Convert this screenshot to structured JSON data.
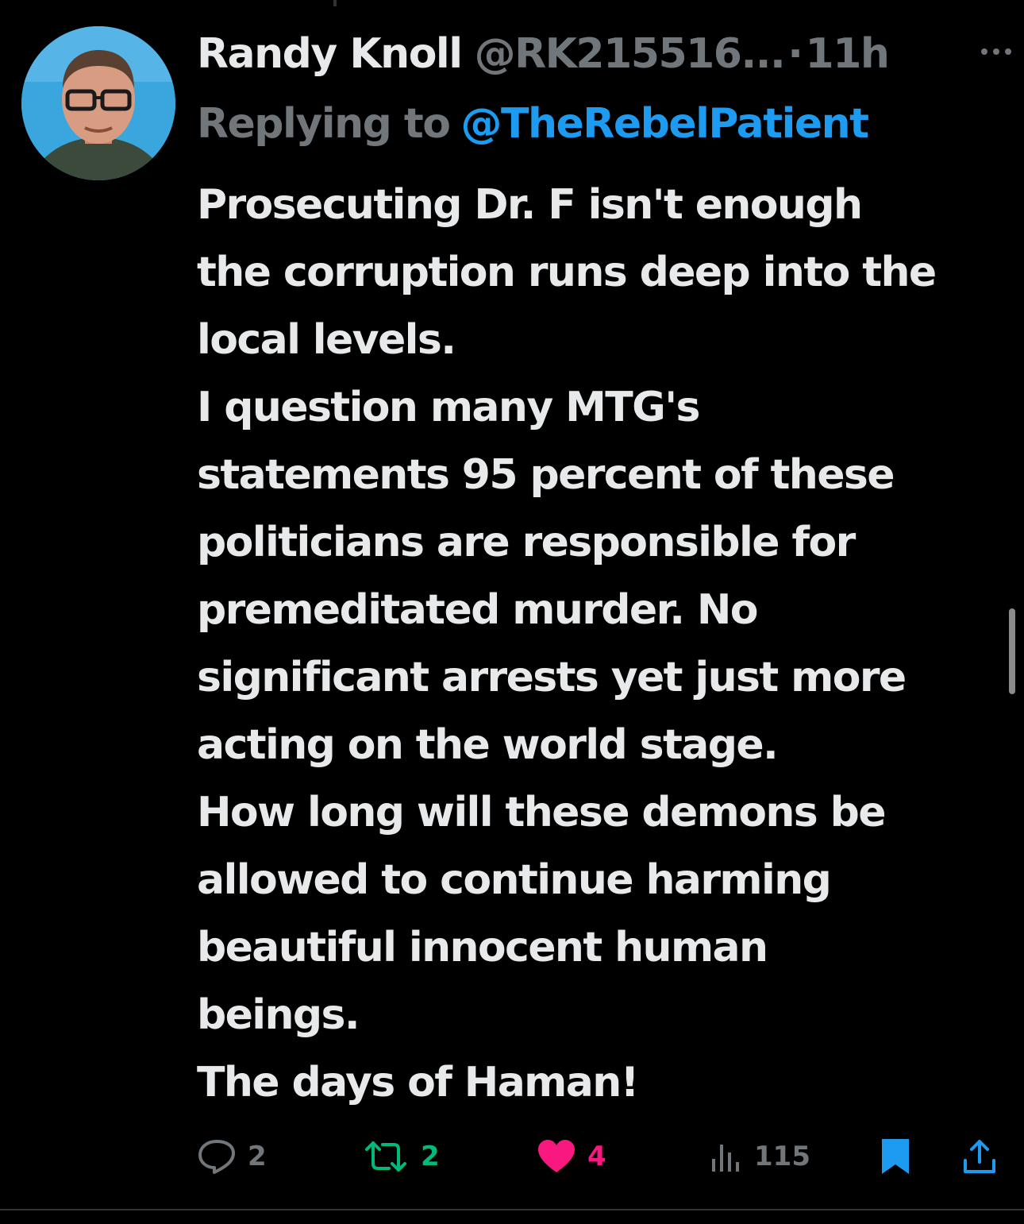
{
  "tweet": {
    "author": {
      "name": "Randy Knoll",
      "handle": "@RK215516...",
      "avatar_icon": "profile-photo"
    },
    "separator": "·",
    "time": "11h",
    "more_icon": "ellipsis-icon",
    "replying_to": {
      "prefix": "Replying to",
      "mention": "@TheRebelPatient"
    },
    "text_lines": [
      "Prosecuting Dr. F isn't enough",
      "the corruption runs deep into the",
      "local levels.",
      "I question many MTG's",
      "statements 95 percent of these",
      "politicians are responsible for",
      "premeditated murder. No",
      "significant arrests yet just more",
      "acting on the world stage.",
      "How long will these demons be",
      "allowed to continue harming",
      "beautiful innocent human",
      "beings.",
      "The days of Haman!"
    ],
    "actions": {
      "replies": {
        "icon": "reply-icon",
        "count": "2",
        "color": "#71767b"
      },
      "reposts": {
        "icon": "repost-icon",
        "count": "2",
        "color": "#00ba7c"
      },
      "likes": {
        "icon": "heart-icon",
        "count": "4",
        "color": "#f91880"
      },
      "views": {
        "icon": "views-icon",
        "count": "115",
        "color": "#71767b"
      },
      "bookmark": {
        "icon": "bookmark-icon",
        "color": "#1d9bf0"
      },
      "share": {
        "icon": "share-icon",
        "color": "#1d9bf0"
      }
    }
  },
  "colors": {
    "background": "#000000",
    "text": "#e7e9ea",
    "secondary": "#71767b",
    "accent": "#1d9bf0"
  }
}
